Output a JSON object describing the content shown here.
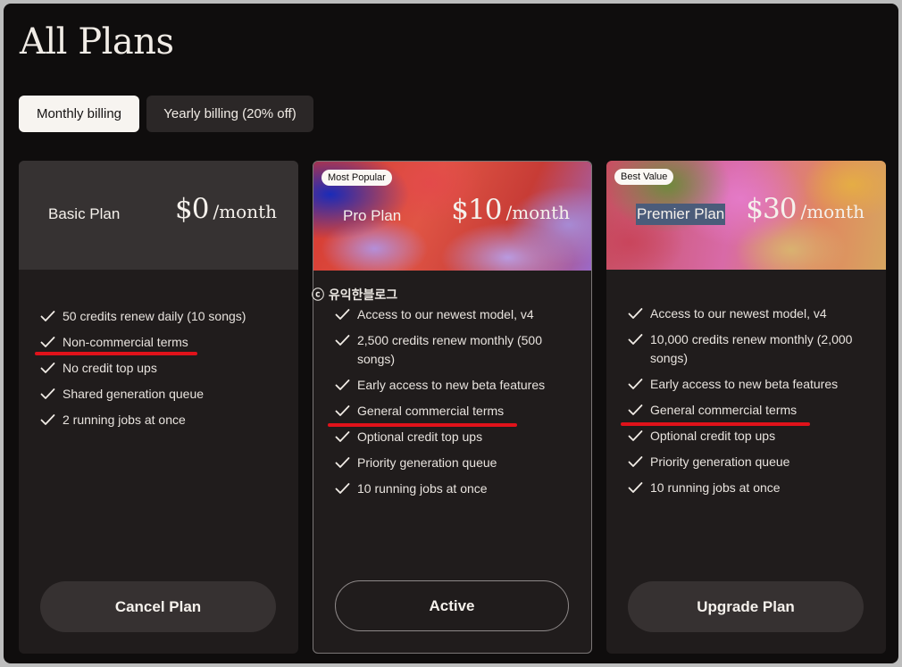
{
  "page": {
    "title": "All Plans"
  },
  "billing": {
    "monthly_label": "Monthly billing",
    "yearly_label": "Yearly billing (20% off)",
    "selected": "monthly"
  },
  "plans": [
    {
      "name": "Basic Plan",
      "price": "$0",
      "period": "/month",
      "badge": "",
      "features": [
        "50 credits renew daily (10 songs)",
        "Non-commercial terms",
        "No credit top ups",
        "Shared generation queue",
        "2 running jobs at once"
      ],
      "highlighted_feature": "Non-commercial terms",
      "action_label": "Cancel Plan"
    },
    {
      "name": "Pro Plan",
      "price": "$10",
      "period": "/month",
      "badge": "Most Popular",
      "features": [
        "Access to our newest model, v4",
        "2,500 credits renew monthly (500 songs)",
        "Early access to new beta features",
        "General commercial terms",
        "Optional credit top ups",
        "Priority generation queue",
        "10 running jobs at once"
      ],
      "highlighted_feature": "General commercial terms",
      "action_label": "Active"
    },
    {
      "name": "Premier Plan",
      "price": "$30",
      "period": "/month",
      "badge": "Best Value",
      "features": [
        "Access to our newest model, v4",
        "10,000 credits renew monthly (2,000 songs)",
        "Early access to new beta features",
        "General commercial terms",
        "Optional credit top ups",
        "Priority generation queue",
        "10 running jobs at once"
      ],
      "highlighted_feature": "General commercial terms",
      "action_label": "Upgrade Plan"
    }
  ],
  "watermark": "ⓒ 유익한블로그",
  "colors": {
    "background": "#0f0d0d",
    "card": "#201c1c",
    "highlight_underline": "#e0121a"
  },
  "icons": {
    "feature_bullet": "check-icon"
  }
}
